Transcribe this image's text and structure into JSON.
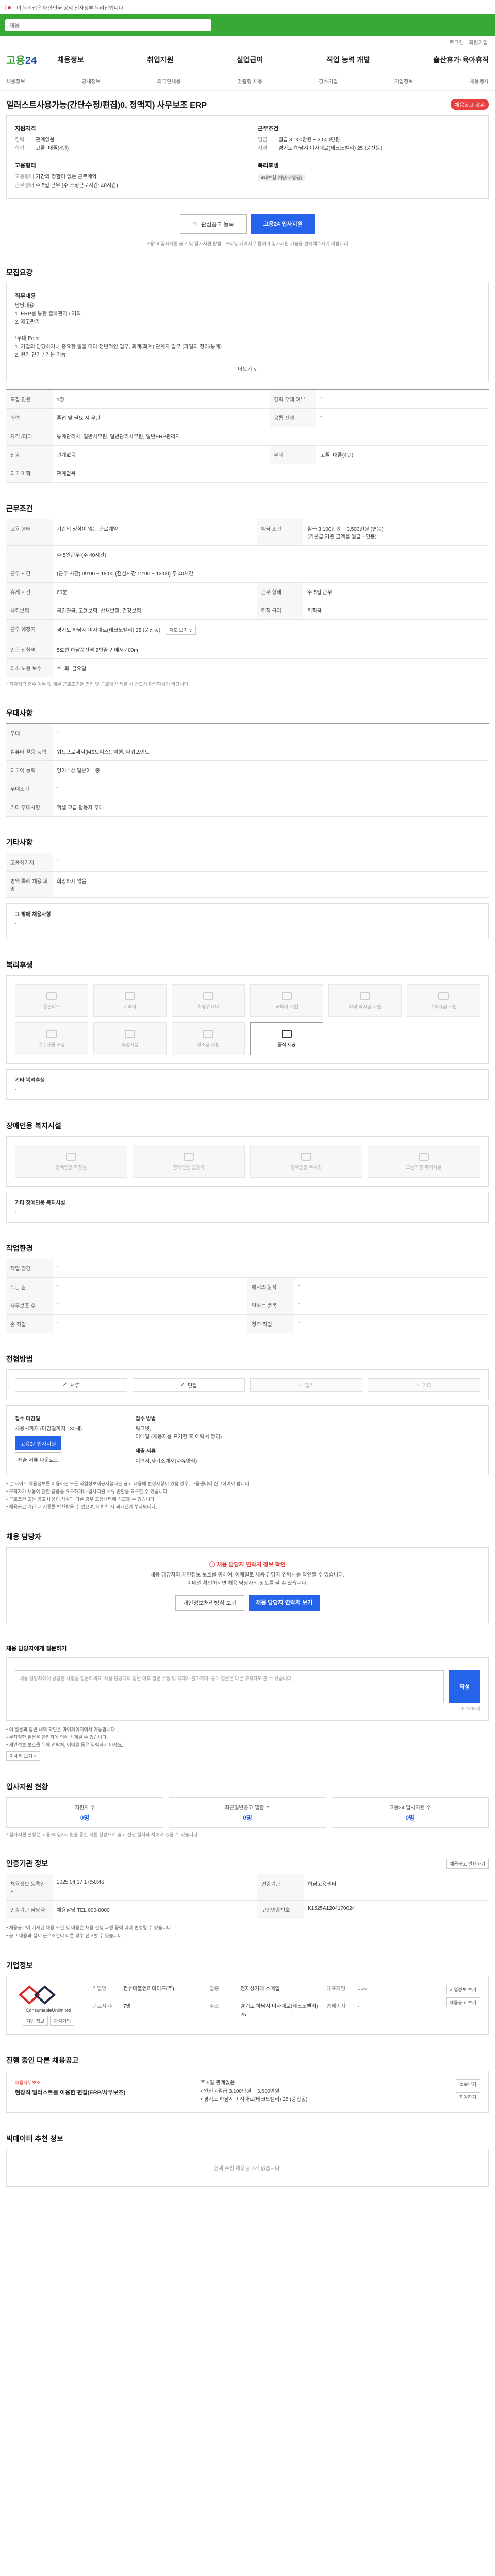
{
  "topbar": {
    "notice": "이 누리집은 대한민국 공식 전자정부 누리집입니다."
  },
  "search": {
    "placeholder": "채용"
  },
  "util": {
    "login": "로그인",
    "join": "회원가입"
  },
  "header": {
    "logo_main": "고용",
    "logo_sub": "24",
    "menu": [
      "채용정보",
      "취업지원",
      "실업급여",
      "직업 능력 개발",
      "출산휴가·육아휴직"
    ]
  },
  "lnb": [
    "채용정보",
    "공채정보",
    "외국인채용",
    "맞춤형 채용",
    "강소기업",
    "기업정보",
    "채용행사"
  ],
  "title": {
    "text": "일러스트사용가능(간단수정/편집)0, 정액지) 사무보조 ERP",
    "share": "채용공고 공유"
  },
  "summary": {
    "company_head": "지원자격",
    "company": [
      {
        "k": "경력",
        "v": "관계없음"
      },
      {
        "k": "학력",
        "v": "고졸~대졸(4년)"
      }
    ],
    "cond_head": "근무조건",
    "cond": [
      {
        "k": "임금",
        "v": "월급 3,100만원 ~ 3,500만원"
      },
      {
        "k": "지역",
        "v": "경기도 하남시 미사대로(테크노밸리) 25 (풍산동)"
      }
    ],
    "type_head": "고용형태",
    "type": [
      {
        "k": "고용형태",
        "v": "기간의 정함이 없는 근로계약"
      },
      {
        "k": "근무형태",
        "v": "주 5일 근무 (주 소정근로시간: 40시간)"
      }
    ],
    "welfare_head": "복리후생",
    "welfare_chip": "4대보험 해당(사업장)"
  },
  "buttons": {
    "wish": "관심공고 등록",
    "apply": "고용24 입사지원"
  },
  "apply_note": "고용24 입사지원 공고 및 입사지원 방법 : 모바일 페이지로 들어가 입사지원 기능을 선택해주시기 바랍니다.",
  "sections": {
    "detail": "모집요강",
    "work": "근무조건",
    "prefer": "우대사항",
    "etc": "기타사항",
    "welfare": "복리후생",
    "disability": "장애인용 복지시설",
    "environment": "작업환경",
    "method": "전형방법",
    "contact": "채용 담당자",
    "qa": "채용 담당자에게 질문하기",
    "apply_status": "입사지원 현황",
    "posting": "인증기관 정보",
    "company": "기업정보",
    "recommend": "진행 중인 다른 채용공고",
    "ai": "빅데이터 추천 정보"
  },
  "detail": {
    "h1": "직무내용",
    "p1": "담당내용:",
    "lines": [
      "1. ERP를 통한 출하관리 / 기획",
      "2. 제고관리",
      "",
      "*우대 Point",
      "1. 기업의 담당하거나 중요한 일을 따라 전반적인 업무, 회계(회계) 관계자 업무 (파일의 정리/통계)",
      "2. 원가 단가 / 기본 기능"
    ],
    "more": "더보기 ∨",
    "rows": [
      {
        "k": "모집 인원",
        "v": "1명",
        "k2": "경력 우대 여부",
        "v2": "-"
      },
      {
        "k": "학력",
        "v": "졸업 및 필요 시 무관",
        "k2": "공통 전형",
        "v2": "-"
      },
      {
        "k": "자격 /리더",
        "v": "통계관리사, 일반사무원, 일반관리사무원, 일반ERP관리자",
        "k2": "",
        "v2": ""
      },
      {
        "k": "전공",
        "v": "관계없음",
        "k2": "우대",
        "v2": "고졸~대졸(4년)"
      },
      {
        "k": "외국 어학",
        "v": "관계없음",
        "k2": "",
        "v2": ""
      }
    ]
  },
  "work": {
    "rows": [
      {
        "k": "고용 형태",
        "v": "기간의 정함이 없는 근로계약",
        "k2": "임금 조건",
        "v2": "월급 3,100만원 ~ 3,500만원 (연봉)\n(기본급 기준 금액을 월급 - 연봉)"
      },
      {
        "k": "",
        "v": "주 5일근무 (주 40시간)",
        "k2": "",
        "v2": ""
      },
      {
        "k": "근무 시간",
        "v": "(근무 시간) 09:00 ~ 18:00 (점심시간 12:00 ~ 13:00) 주 40시간",
        "k2": "",
        "v2": ""
      },
      {
        "k": "휴게 시간",
        "v": "60분",
        "k2": "근무 형태",
        "v2": "주 5일 근무"
      },
      {
        "k": "사회보험",
        "v": "국민연금, 고용보험, 산재보험, 건강보험",
        "k2": "퇴직 급여",
        "v2": "퇴직금"
      },
      {
        "k": "근무 예정지",
        "v": "경기도 하남시 미사대로(테크노밸리) 25 (풍산동)",
        "k2": "",
        "v2": ""
      },
      {
        "k": "인근 전철역",
        "v": "5호선 하남풍산역 2번출구 에서 400m",
        "k2": "",
        "v2": ""
      },
      {
        "k": "최소 노동 보수",
        "v": "수, 퇴, 금요일",
        "k2": "",
        "v2": ""
      }
    ],
    "map_btn": "지도 보기 ∨",
    "note": "* 최저임금 준수 여부 및 세부 근로조건은 면접 및 근로계약 체결 시 반드시 확인하시기 바랍니다."
  },
  "prefer": {
    "rows": [
      {
        "k": "우대",
        "v": "-"
      },
      {
        "k": "컴퓨터 활용 능력",
        "v": "워드프로세서(MS오피스), 엑셀, 파워포인트"
      },
      {
        "k": "외국어 능력",
        "v": "영어 : 상    일본어 : 중"
      },
      {
        "k": "우대조건",
        "v": "-"
      },
      {
        "k": "기타 우대사항",
        "v": "엑셀 고급 활용자 우대"
      }
    ]
  },
  "etc": {
    "rows": [
      {
        "k": "고용허가제",
        "v": "-"
      },
      {
        "k": "병역 특례 채용 희망",
        "v": "희망하지 않음"
      }
    ],
    "extra_title": "그 밖에 채용사항",
    "extra_val": "-"
  },
  "welfare": {
    "items": [
      {
        "label": "통근버스",
        "on": false
      },
      {
        "label": "기숙사",
        "on": false
      },
      {
        "label": "차량유지비",
        "on": false
      },
      {
        "label": "교육비 지원",
        "on": false
      },
      {
        "label": "자녀 학자금 지원",
        "on": false
      },
      {
        "label": "주택자금 지원",
        "on": false
      },
      {
        "label": "우수사원 포상",
        "on": false
      },
      {
        "label": "휴양시설",
        "on": false
      },
      {
        "label": "경조금 지원",
        "on": false
      },
      {
        "label": "중식 제공",
        "on": true
      }
    ],
    "extra_title": "기타 복리후생",
    "extra_val": "-"
  },
  "disability": {
    "items": [
      "장애인용 화장실",
      "장애인용 승강기",
      "장애인용 주차장",
      "그룹가정 복리시설"
    ],
    "extra_title": "기타 장애인용 복지시설",
    "extra_val": "-"
  },
  "environment": {
    "rows": [
      {
        "k": "작업 환경",
        "v": "-",
        "k2": "",
        "v2": ""
      },
      {
        "k": "드는 힘",
        "v": "-",
        "k2": "에서의 동작",
        "v2": "-"
      },
      {
        "k": "사무보조 수",
        "v": "-",
        "k2": "일하는 품목",
        "v2": "-"
      },
      {
        "k": "손 작업",
        "v": "-",
        "k2": "청각 작업",
        "v2": "-"
      }
    ]
  },
  "method": {
    "items": [
      {
        "label": "서류",
        "off": false
      },
      {
        "label": "면접",
        "off": false
      },
      {
        "label": "필기",
        "off": true
      },
      {
        "label": "기타",
        "off": true
      }
    ],
    "deadline_head": "접수 마감일",
    "deadline_val": "채용시까지 (마감일까지 : 30세)",
    "way_head": "접수 방법",
    "way_lines": [
      "워크넷,",
      "이메일 (채용자를 표기한 후 이력서 정리)"
    ],
    "doc_head": "제출 서류",
    "doc_lines": [
      "이력서,자기소개서(자유양식)"
    ],
    "btn_apply": "고용24 입사지원",
    "btn_doc": "제출 서류 다운로드",
    "notes": [
      "• 본 사이트 채용정보를 이용하는 모든 직업정보제공사업자는 공고 내용에 변경사항이 있을 경우, 고용센터에 신고하여야 합니다.",
      "• 구직자가 채용에 관한 금품을 요구하거나 입사지원 서류 반환을 요구할 수 있습니다.",
      "• 근로조건 또는 공고 내용이 사실과 다른 경우 고용센터에 신고할 수 있습니다.",
      "• 채용공고 기간 내 서류를 반환받을 수 있으며, 미반환 시 과태료가 부과됩니다."
    ]
  },
  "contact": {
    "warn": "채용 담당자 연락처 정보 확인",
    "p": "채용 담당자의 개인정보 보호를 위하여, 이메일로 채용 담당자 연락처를 확인할 수 있습니다.\n이메일 확인하시면 채용 담당자의 정보를 볼 수 있습니다.",
    "btn1": "개인정보처리방침 보기",
    "btn2": "채용 담당자 연락처 보기"
  },
  "qa": {
    "placeholder": "채용 담당자에게 궁금한 사항을 질문하세요. 채용 담당자의 답변 이후 질문 수정 및 삭제가 불가하며, 공개 질문은 다른 구직자도 볼 수 있습니다.",
    "submit": "작성",
    "count": "0 / 300자",
    "notes": [
      "• 이 질문과 답변 내역 확인은 마이페이지에서 가능합니다.",
      "• 부적절한 질문은 관리자에 의해 삭제될 수 있습니다.",
      "• 개인정보 보호를 위해 연락처, 이메일 등은 입력하지 마세요."
    ],
    "policy_link": "자세히 보기 >"
  },
  "apply_status": {
    "items": [
      {
        "label": "지원자 수",
        "value": "0명"
      },
      {
        "label": "최근일반공고 열람 수",
        "value": "0명"
      },
      {
        "label": "고용24 입사지원 수",
        "value": "0명"
      }
    ],
    "note": "* 입사지원 현황은 고용24 입사지원을 통한 지원 현황으로 공고 신청 일자와 차이가 있을 수 있습니다."
  },
  "posting": {
    "rows": [
      {
        "k": "채용정보 등록일시",
        "v": "2025.04.17 17:50:46",
        "k2": "인증기관",
        "v2": "하남고용센터"
      },
      {
        "k": "인증기관 담당자",
        "v": "채용담당 TEL 000-0000",
        "k2": "구인인증번호",
        "v2": "K1525A1204170024"
      }
    ],
    "print_btn": "채용공고 인쇄하기",
    "notes": [
      "• 채용공고에 기재된 채용 조건 및 내용은 채용 진행 과정 등에 따라 변경될 수 있습니다.",
      "• 공고 내용과 실제 근로조건이 다른 경우 신고할 수 있습니다."
    ]
  },
  "company": {
    "name": "ConsumableUnlimited",
    "btns": [
      "기업 정보",
      "관심기업"
    ],
    "rows": [
      {
        "k": "기업명",
        "v": "컨슈머블언리미티드(주)"
      },
      {
        "k": "업종",
        "v": "전자상거래 소매업"
      },
      {
        "k": "대표자명",
        "v": "○○○"
      },
      {
        "k": "근로자 수",
        "v": "7명"
      },
      {
        "k": "주소",
        "v": "경기도 하남시 미사대로(테크노밸리) 25"
      },
      {
        "k": "홈페이지",
        "v": "-"
      }
    ],
    "side_btns": [
      "기업정보 보기",
      "채용공고 보기"
    ]
  },
  "recommend": {
    "head": "채용사무보조",
    "title": "현장직 일러스트를 이용한 편집(ERP/사무보조)",
    "lines": [
      "주 5일   관계없음",
      "• 일일 • 월급 3,100만원 ~ 3,500만원",
      "• 경기도 하남시 미사대로(테크노밸리) 25 (풍산동)"
    ],
    "btns": [
      "목록보기",
      "지원하기"
    ]
  },
  "ai": {
    "empty": "현재 추천 채용공고가 없습니다."
  }
}
